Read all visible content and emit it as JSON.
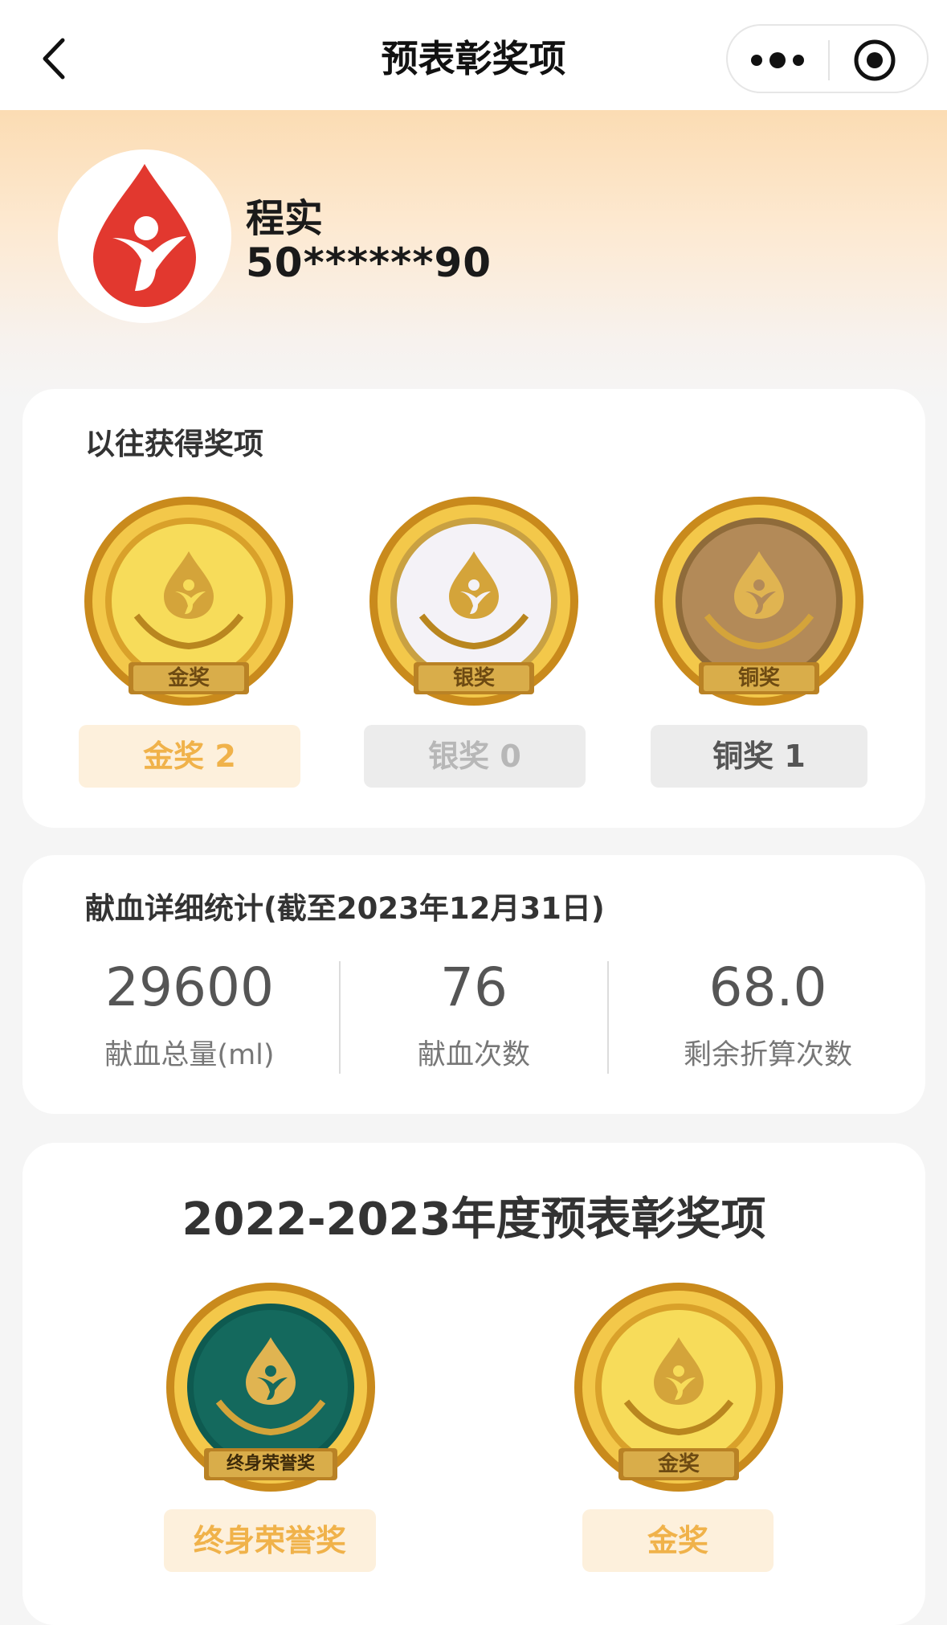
{
  "nav": {
    "title": "预表彰奖项"
  },
  "user": {
    "name": "程实",
    "id": "50******90"
  },
  "past_awards": {
    "title": "以往获得奖项",
    "medals": [
      {
        "medal_text": "金奖",
        "pill": "金奖 2"
      },
      {
        "medal_text": "银奖",
        "pill": "银奖 0"
      },
      {
        "medal_text": "铜奖",
        "pill": "铜奖 1"
      }
    ]
  },
  "stats": {
    "title": "献血详细统计(截至2023年12月31日)",
    "items": [
      {
        "value": "29600",
        "label": "献血总量(ml)"
      },
      {
        "value": "76",
        "label": "献血次数"
      },
      {
        "value": "68.0",
        "label": "剩余折算次数"
      }
    ]
  },
  "annual": {
    "title": "2022-2023年度预表彰奖项",
    "awards": [
      {
        "medal_text": "终身荣誉奖",
        "pill": "终身荣誉奖"
      },
      {
        "medal_text": "金奖",
        "pill": "金奖"
      }
    ]
  },
  "colors": {
    "gold_pill_bg": "#fdf0dc",
    "gold_pill_text": "#f0b24a",
    "silver_pill_bg": "#ececec",
    "silver_pill_text": "#b7b7b7",
    "bronze_pill_bg": "#ececec",
    "bronze_pill_text": "#555555",
    "brand_red": "#e2382f"
  }
}
